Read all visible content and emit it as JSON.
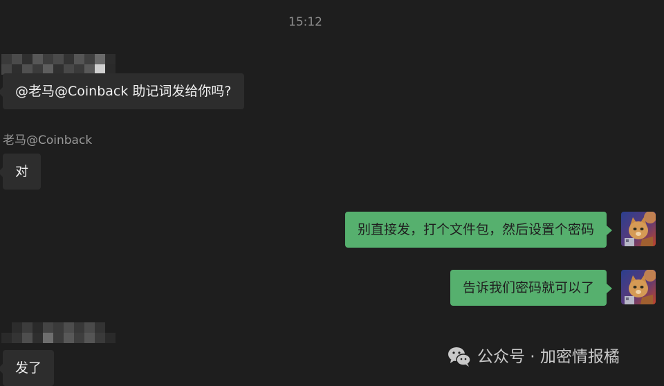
{
  "chat": {
    "timestamp": "15:12",
    "messages": [
      {
        "direction": "in",
        "sender": "",
        "text": "@老马@Coinback 助记词发给你吗?"
      },
      {
        "direction": "in",
        "sender": "老马@Coinback",
        "text": "对"
      },
      {
        "direction": "out",
        "text": "别直接发，打个文件包，然后设置个密码"
      },
      {
        "direction": "out",
        "text": "告诉我们密码就可以了"
      },
      {
        "direction": "in",
        "sender": "",
        "text": "发了"
      }
    ]
  },
  "watermark": {
    "text": "公众号 · 加密情报橘",
    "icon": "wechat-icon"
  },
  "colors": {
    "background": "#1e1e1e",
    "incoming_bubble": "#2d2d2d",
    "outgoing_bubble": "#56b06e"
  }
}
